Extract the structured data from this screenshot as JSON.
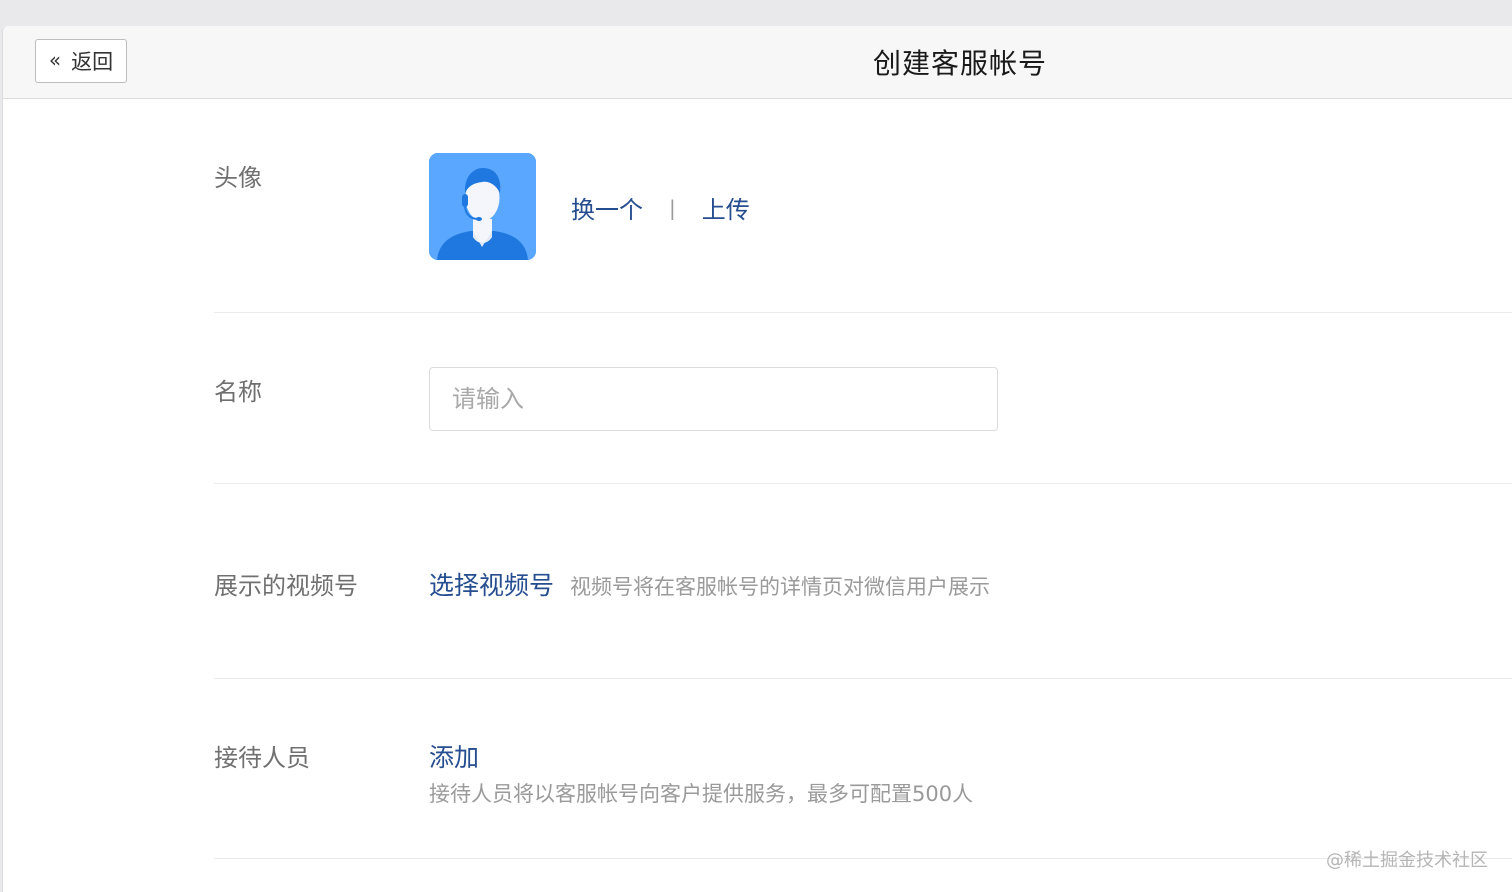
{
  "header": {
    "back_label": "返回",
    "title": "创建客服帐号"
  },
  "avatar_row": {
    "label": "头像",
    "change_label": "换一个",
    "separator": "|",
    "upload_label": "上传"
  },
  "name_row": {
    "label": "名称",
    "input_value": "",
    "placeholder": "请输入"
  },
  "video_row": {
    "label": "展示的视频号",
    "select_label": "选择视频号",
    "hint": "视频号将在客服帐号的详情页对微信用户展示"
  },
  "staff_row": {
    "label": "接待人员",
    "add_label": "添加",
    "hint": "接待人员将以客服帐号向客户提供服务，最多可配置500人"
  },
  "watermark": "@稀土掘金技术社区",
  "colors": {
    "link": "#254d8f",
    "avatar_bg": "#5aa7ff",
    "avatar_figure": "#1e78e0"
  }
}
